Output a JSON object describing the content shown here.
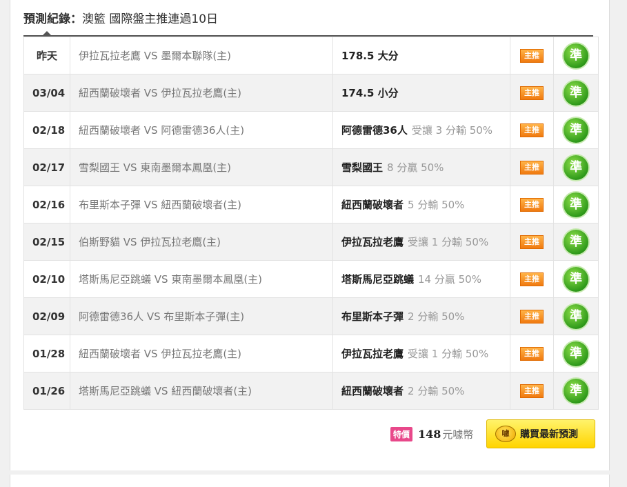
{
  "header": {
    "label": "預測紀錄：",
    "value": "澳籃 國際盤主推連過10日"
  },
  "records": [
    {
      "date": "昨天",
      "match": "伊拉瓦拉老鷹 VS 墨爾本聯隊(主)",
      "pick": "178.5 大分",
      "detail": "",
      "tag": "主推",
      "result": "準"
    },
    {
      "date": "03/04",
      "match": "紐西蘭破壞者 VS 伊拉瓦拉老鷹(主)",
      "pick": "174.5 小分",
      "detail": "",
      "tag": "主推",
      "result": "準"
    },
    {
      "date": "02/18",
      "match": "紐西蘭破壞者 VS 阿德雷德36人(主)",
      "pick": "阿德雷德36人",
      "detail": "受讓 3 分輸 50%",
      "tag": "主推",
      "result": "準"
    },
    {
      "date": "02/17",
      "match": "雪梨國王 VS 東南墨爾本鳳凰(主)",
      "pick": "雪梨國王",
      "detail": "8 分贏 50%",
      "tag": "主推",
      "result": "準"
    },
    {
      "date": "02/16",
      "match": "布里斯本子彈 VS 紐西蘭破壞者(主)",
      "pick": "紐西蘭破壞者",
      "detail": "5 分輸 50%",
      "tag": "主推",
      "result": "準"
    },
    {
      "date": "02/15",
      "match": "伯斯野貓 VS 伊拉瓦拉老鷹(主)",
      "pick": "伊拉瓦拉老鷹",
      "detail": "受讓 1 分輸 50%",
      "tag": "主推",
      "result": "準"
    },
    {
      "date": "02/10",
      "match": "塔斯馬尼亞跳蟻 VS 東南墨爾本鳳凰(主)",
      "pick": "塔斯馬尼亞跳蟻",
      "detail": "14 分贏 50%",
      "tag": "主推",
      "result": "準"
    },
    {
      "date": "02/09",
      "match": "阿德雷德36人 VS 布里斯本子彈(主)",
      "pick": "布里斯本子彈",
      "detail": "2 分輸 50%",
      "tag": "主推",
      "result": "準"
    },
    {
      "date": "01/28",
      "match": "紐西蘭破壞者 VS 伊拉瓦拉老鷹(主)",
      "pick": "伊拉瓦拉老鷹",
      "detail": "受讓 1 分輸 50%",
      "tag": "主推",
      "result": "準"
    },
    {
      "date": "01/26",
      "match": "塔斯馬尼亞跳蟻 VS 紐西蘭破壞者(主)",
      "pick": "紐西蘭破壞者",
      "detail": "2 分輸 50%",
      "tag": "主推",
      "result": "準"
    }
  ],
  "footer": {
    "sale_tag": "特價",
    "price": "148",
    "unit": "元噱幣",
    "buy_icon": "噱",
    "buy_label": "購買最新預測"
  },
  "colors": {
    "tag_orange": "#f07a10",
    "result_green": "#2f9a1a",
    "buy_yellow": "#ffd400",
    "sale_pink": "#e8488a"
  },
  "icons": {
    "result": "check-badge-icon",
    "buy": "coin-icon"
  }
}
